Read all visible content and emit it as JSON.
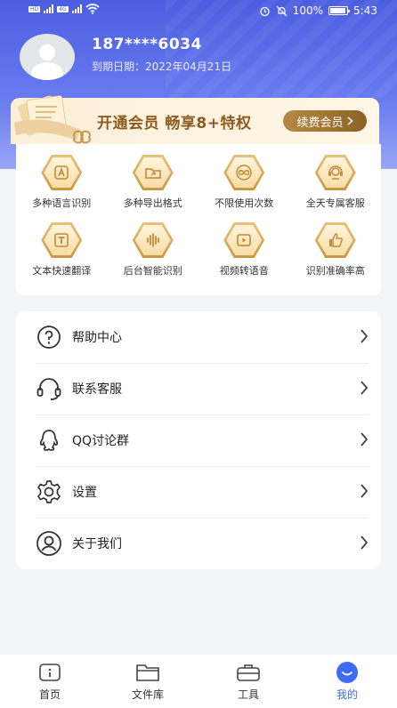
{
  "status_bar": {
    "battery": "100%",
    "time": "5:43",
    "net_tag_1": "HD",
    "net_tag_2": "4G"
  },
  "profile": {
    "phone": "187****6034",
    "expiry": "到期日期：2022年04月21日"
  },
  "vip": {
    "promo_text": "开通会员  畅享8+特权",
    "renew_label": "续费会员"
  },
  "features": [
    {
      "label": "多种语言识别",
      "icon": "language-icon"
    },
    {
      "label": "多种导出格式",
      "icon": "export-folder-icon"
    },
    {
      "label": "不限使用次数",
      "icon": "infinity-icon"
    },
    {
      "label": "全天专属客服",
      "icon": "support-agent-icon"
    },
    {
      "label": "文本快速翻译",
      "icon": "text-t-icon"
    },
    {
      "label": "后台智能识别",
      "icon": "audio-wave-icon"
    },
    {
      "label": "视频转语音",
      "icon": "video-play-icon"
    },
    {
      "label": "识别准确率高",
      "icon": "thumbs-up-icon"
    }
  ],
  "menu": [
    {
      "label": "帮助中心",
      "icon": "help-icon"
    },
    {
      "label": "联系客服",
      "icon": "headset-icon"
    },
    {
      "label": "QQ讨论群",
      "icon": "qq-icon"
    },
    {
      "label": "设置",
      "icon": "gear-icon"
    },
    {
      "label": "关于我们",
      "icon": "user-circle-icon"
    }
  ],
  "tabs": [
    {
      "label": "首页",
      "icon": "home-icon",
      "active": false
    },
    {
      "label": "文件库",
      "icon": "folder-icon",
      "active": false
    },
    {
      "label": "工具",
      "icon": "toolbox-icon",
      "active": false
    },
    {
      "label": "我的",
      "icon": "profile-icon",
      "active": true
    }
  ],
  "colors": {
    "brand": "#4b5ee0",
    "gold": "#c99741",
    "tab_active": "#3e6cf3"
  }
}
